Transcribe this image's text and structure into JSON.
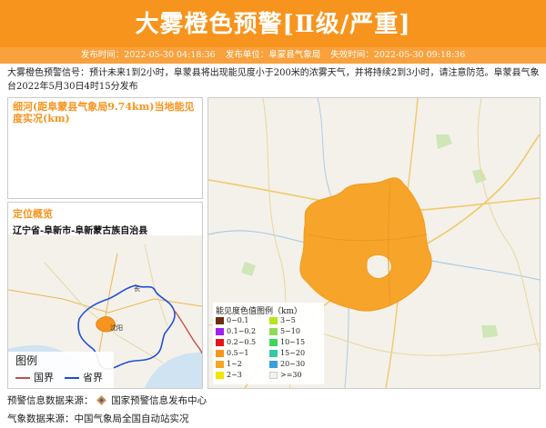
{
  "header": {
    "title": "大雾橙色预警[Ⅱ级/严重]",
    "publish_time": "发布时间：2022-05-30 04:18:36",
    "publisher": "发布单位：阜蒙县气象局",
    "expire_time": "失效时间：2022-05-30 09:18:36"
  },
  "description": "大雾橙色预警信号：预计未来1到2小时，阜蒙县将出现能见度小于200米的浓雾天气，并将持续2到3小时，请注意防范。阜蒙县气象台2022年5月30日4时15分发布",
  "station_panel": {
    "title": "细河(距阜蒙县气象局9.74km)当地能见度实况(km)"
  },
  "location_panel": {
    "title": "定位概览",
    "text": "辽宁省-阜新市-阜新蒙古族自治县",
    "map_labels": {
      "city1": "长",
      "city2": "沈阳"
    }
  },
  "map_legend": {
    "title": "图例",
    "items": [
      {
        "label": "国界",
        "color": "#c0504d"
      },
      {
        "label": "省界",
        "color": "#1f4fd8"
      }
    ]
  },
  "visibility_legend": {
    "title": "能见度色值图例（km）",
    "items": [
      {
        "label": "0~0.1",
        "color": "#6b2e0f"
      },
      {
        "label": "0.1~0.2",
        "color": "#a020f0"
      },
      {
        "label": "0.2~0.5",
        "color": "#e8141c"
      },
      {
        "label": "0.5~1",
        "color": "#f7941d"
      },
      {
        "label": "1~2",
        "color": "#f5a623"
      },
      {
        "label": "2~3",
        "color": "#f2e600"
      },
      {
        "label": "3~5",
        "color": "#b5e61d"
      },
      {
        "label": "5~10",
        "color": "#8fdc5a"
      },
      {
        "label": "10~15",
        "color": "#3fd65a"
      },
      {
        "label": "15~20",
        "color": "#35c9a8"
      },
      {
        "label": "20~30",
        "color": "#3aa0e0"
      },
      {
        "label": ">=30",
        "color": "#f2f2f2"
      }
    ]
  },
  "footer": {
    "warning_source": "预警信息数据来源：",
    "warning_source_name": "国家预警信息发布中心",
    "weather_source": "气象数据来源：中国气象局全国自动站实况"
  },
  "colors": {
    "brand": "#f7941d",
    "fog_area": "#f7a42b"
  }
}
